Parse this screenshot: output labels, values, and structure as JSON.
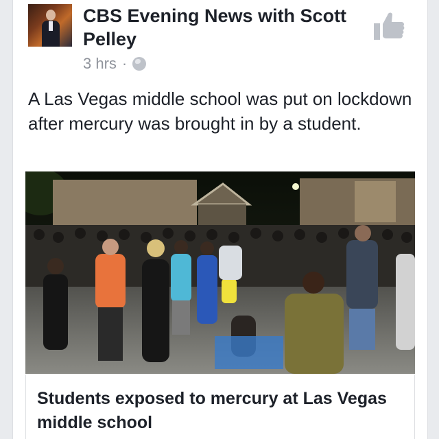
{
  "post": {
    "page_name": "CBS Evening News with Scott Pelley",
    "timestamp": "3 hrs",
    "separator": "·",
    "privacy_icon": "globe-icon",
    "action_icon": "thumbs-up-icon",
    "text": "A Las Vegas middle school was put on lockdown after mercury was brought in by a student."
  },
  "link": {
    "title": "Students exposed to mercury at Las Vegas middle school"
  },
  "colors": {
    "text_primary": "#1d2129",
    "text_secondary": "#90949c",
    "icon_gray": "#bec2c9"
  }
}
